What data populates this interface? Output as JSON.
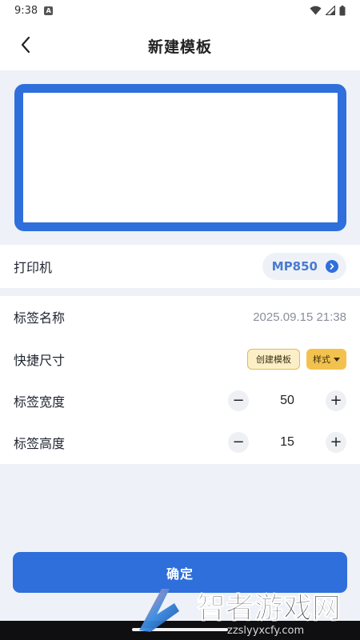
{
  "status_bar": {
    "time": "9:38"
  },
  "header": {
    "title": "新建模板"
  },
  "printer": {
    "label": "打印机",
    "value": "MP850"
  },
  "settings": {
    "label_name": {
      "label": "标签名称",
      "value": "2025.09.15 21:38"
    },
    "quick_size": {
      "label": "快捷尺寸",
      "create_template_label": "创建模板",
      "style_label": "样式"
    },
    "label_width": {
      "label": "标签宽度",
      "value": "50",
      "minus": "−",
      "plus": "+"
    },
    "label_height": {
      "label": "标签高度",
      "value": "15",
      "minus": "−",
      "plus": "+"
    }
  },
  "confirm_button": "确定",
  "watermark": {
    "title": "智者游戏网",
    "url": "zzslyyxcfy.com"
  },
  "colors": {
    "accent": "#2f6fdb",
    "page_bg": "#eef1f7",
    "chip_yellow": "#f3c24e",
    "chip_light_yellow": "#fcefc8"
  }
}
